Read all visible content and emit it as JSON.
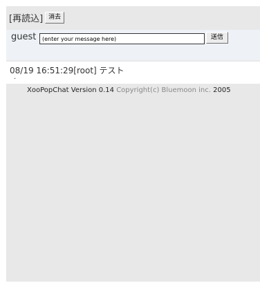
{
  "toolbar": {
    "reload_label": "[再読込]",
    "clear_label": "消去"
  },
  "input": {
    "username": "guest",
    "message_value": "(enter your message here)",
    "send_label": "送信"
  },
  "log": {
    "entries": [
      {
        "text": "08/19 16:51:29[root] テスト"
      }
    ],
    "trailing": "."
  },
  "footer": {
    "product": "XooPopChat Version 0.14",
    "copyright": "Copyright(c) Bluemoon inc.",
    "year": "2005"
  }
}
